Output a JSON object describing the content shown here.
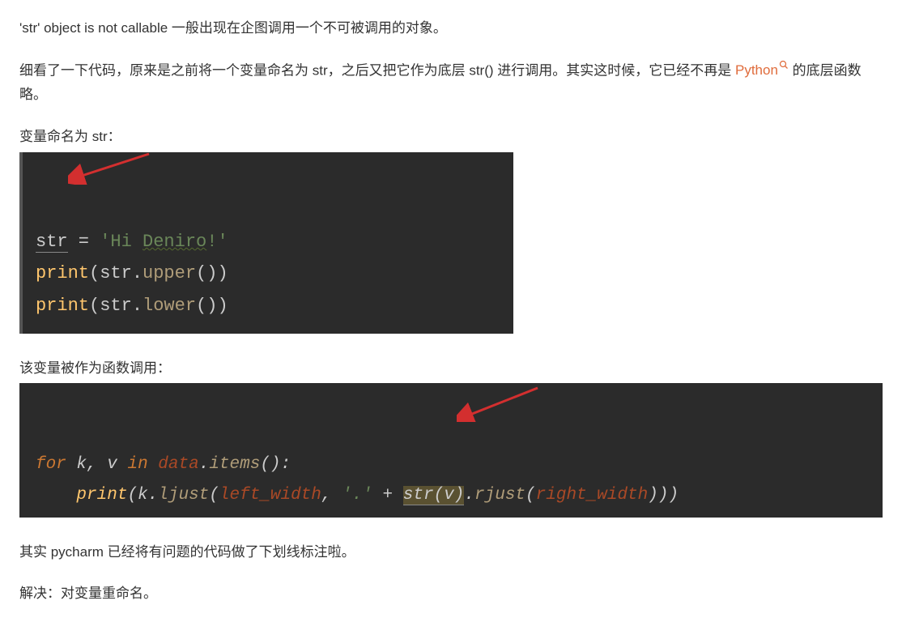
{
  "para1": "'str' object is not callable 一般出现在企图调用一个不可被调用的对象。",
  "para2_a": "细看了一下代码，原来是之前将一个变量命名为 str，之后又把它作为底层 str() 进行调用。其实这时候，它已经不再是 ",
  "link_text": "Python",
  "para2_b": " 的底层函数略。",
  "para3": "变量命名为 str：",
  "code1": {
    "l1_var": "str",
    "l1_eq": " = ",
    "l1_q1": "'",
    "l1_s1": "Hi ",
    "l1_s2": "Deniro",
    "l1_s3": "!",
    "l1_q2": "'",
    "l2_fn": "print",
    "l2_open": "(",
    "l2_obj": "str.",
    "l2_call": "upper",
    "l2_p": "()",
    "l2_close": ")",
    "l3_fn": "print",
    "l3_open": "(",
    "l3_obj": "str.",
    "l3_call": "lower",
    "l3_p": "()",
    "l3_close": ")"
  },
  "para4": "该变量被作为函数调用：",
  "code2": {
    "l1_for": "for ",
    "l1_k": "k",
    "l1_c1": ", ",
    "l1_v": "v",
    "l1_in": " in ",
    "l1_data": "data",
    "l1_dot": ".",
    "l1_items": "items",
    "l1_p": "():",
    "indent": "    ",
    "l2_fn": "print",
    "l2_open": "(",
    "l2_k": "k",
    "l2_dot1": ".",
    "l2_ljust": "ljust",
    "l2_open2": "(",
    "l2_lw": "left_width",
    "l2_c1": ", ",
    "l2_str": "'.'",
    "l2_plus": " + ",
    "l2_strcall": "str",
    "l2_op3": "(",
    "l2_vv": "v",
    "l2_cp3": ")",
    "l2_dot2": ".",
    "l2_rjust": "rjust",
    "l2_op4": "(",
    "l2_rw": "right_width",
    "l2_cp4": ")))"
  },
  "para5": "其实 pycharm 已经将有问题的代码做了下划线标注啦。",
  "para6": "解决：对变量重命名。"
}
